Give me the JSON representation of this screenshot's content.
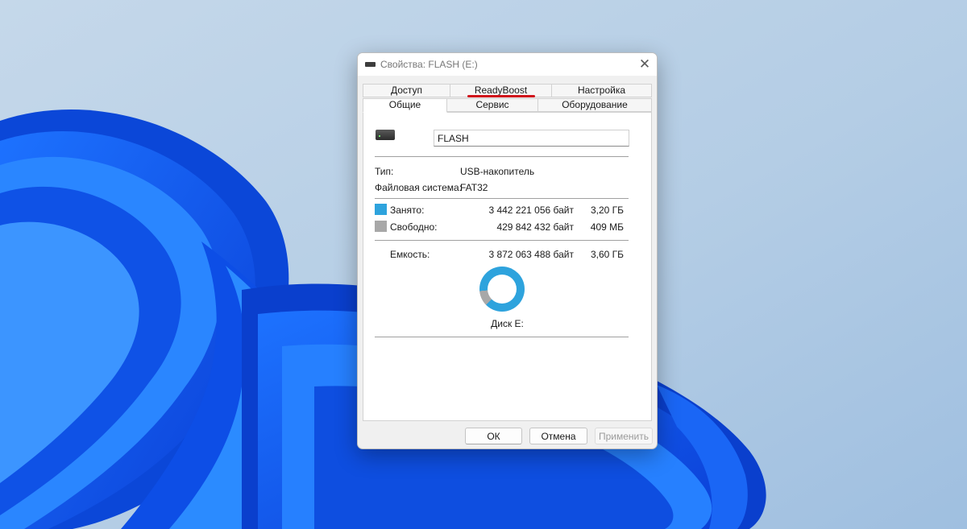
{
  "window": {
    "title": "Свойства: FLASH (E:)",
    "close_glyph": "✕"
  },
  "tabs": {
    "row1": [
      "Доступ",
      "ReadyBoost",
      "Настройка"
    ],
    "row2": [
      "Общие",
      "Сервис",
      "Оборудование"
    ],
    "active": "Общие",
    "highlighted": "ReadyBoost",
    "highlight_color": "#d0101b"
  },
  "general": {
    "drive_name": "FLASH",
    "type_label": "Тип:",
    "type_value": "USB-накопитель",
    "fs_label": "Файловая система:",
    "fs_value": "FAT32",
    "used": {
      "label": "Занято:",
      "bytes": "3 442 221 056 байт",
      "size": "3,20 ГБ",
      "color": "#2ea3dd"
    },
    "free": {
      "label": "Свободно:",
      "bytes": "429 842 432 байт",
      "size": "409 МБ",
      "color": "#a8a8a8"
    },
    "capacity": {
      "label": "Емкость:",
      "bytes": "3 872 063 488 байт",
      "size": "3,60 ГБ"
    },
    "used_fraction": 0.889,
    "disk_label": "Диск E:"
  },
  "buttons": {
    "ok": "ОК",
    "cancel": "Отмена",
    "apply": "Применить"
  },
  "icons": {
    "title_icon": "drive-icon",
    "drive_icon": "usb-drive-icon",
    "close": "close-icon"
  }
}
